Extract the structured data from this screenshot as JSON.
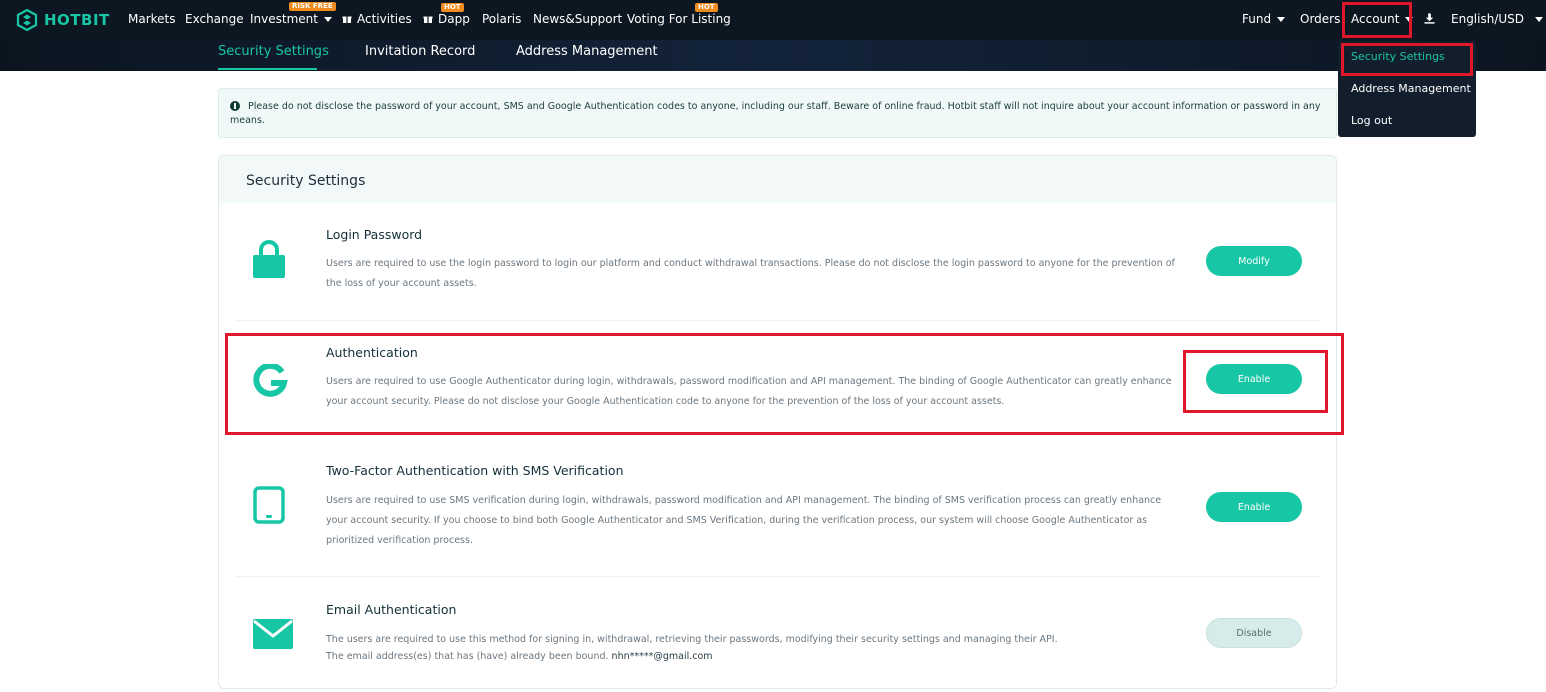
{
  "brand": {
    "name": "HOTBIT",
    "accent": "#17c6a4",
    "highlight": "#e0162b"
  },
  "nav": {
    "items": [
      {
        "label": "Markets"
      },
      {
        "label": "Exchange"
      },
      {
        "label": "Investment",
        "badge": "RISK FREE"
      },
      {
        "label": "Activities"
      },
      {
        "label": "Dapp",
        "badge": "HOT"
      },
      {
        "label": "Polaris"
      },
      {
        "label": "News&Support"
      },
      {
        "label": "Voting For Listing",
        "badge": "HOT"
      }
    ],
    "right": {
      "fund": "Fund",
      "orders": "Orders",
      "account": "Account",
      "language": "English/USD"
    }
  },
  "subnav": {
    "tabs": [
      "Security Settings",
      "Invitation Record",
      "Address Management"
    ],
    "active": 0
  },
  "account_menu": {
    "items": [
      "Security Settings",
      "Address Management",
      "Log out"
    ],
    "active": 0
  },
  "notice": "Please do not disclose the password of your account, SMS and Google Authentication codes to anyone, including our staff. Beware of online fraud. Hotbit staff will not inquire about your account information or password in any means.",
  "security": {
    "title": "Security Settings",
    "rows": [
      {
        "icon": "lock-icon",
        "title": "Login Password",
        "desc": "Users are required to use the login password to login our platform and conduct withdrawal transactions. Please do not disclose the login password to anyone for the prevention of the loss of your account assets.",
        "button": "Modify"
      },
      {
        "icon": "google-icon",
        "title": "Authentication",
        "desc": "Users are required to use Google Authenticator during login, withdrawals, password modification and API management. The binding of Google Authenticator can greatly enhance your account security. Please do not disclose your Google Authentication code to anyone for the prevention of the loss of your account assets.",
        "button": "Enable"
      },
      {
        "icon": "tablet-icon",
        "title": "Two-Factor Authentication with SMS Verification",
        "desc": "Users are required to use SMS verification during login, withdrawals, password modification and API management. The binding of SMS verification process can greatly enhance your account security. If you choose to bind both Google Authenticator and SMS Verification, during the verification process, our system will choose Google Authenticator as prioritized verification process.",
        "button": "Enable"
      },
      {
        "icon": "envelope-icon",
        "title": "Email Authentication",
        "desc": "The users are required to use this method for signing in, withdrawal, retrieving their passwords, modifying their security settings and managing their API.",
        "desc2_prefix": "The email address(es) that has (have) already been bound.",
        "email": "nhn*****@gmail.com",
        "button": "Disable"
      }
    ]
  }
}
